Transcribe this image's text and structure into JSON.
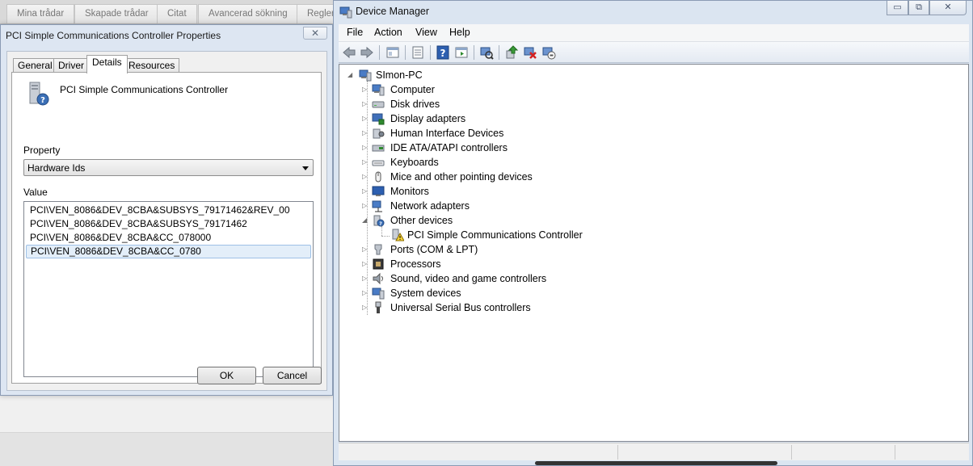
{
  "background_tabs": [
    "Mina trådar",
    "Skapade trådar",
    "Citat",
    "Avancerad sökning",
    "Regler"
  ],
  "properties_dialog": {
    "title": "PCI Simple Communications Controller Properties",
    "close_glyph": "✕",
    "tabs": [
      {
        "label": "General",
        "active": false
      },
      {
        "label": "Driver",
        "active": false
      },
      {
        "label": "Details",
        "active": true
      },
      {
        "label": "Resources",
        "active": false
      }
    ],
    "device_icon": "unknown-device-icon",
    "device_name": "PCI Simple Communications Controller",
    "property_label": "Property",
    "property_value": "Hardware Ids",
    "value_label": "Value",
    "values": [
      {
        "text": "PCI\\VEN_8086&DEV_8CBA&SUBSYS_79171462&REV_00",
        "selected": false
      },
      {
        "text": "PCI\\VEN_8086&DEV_8CBA&SUBSYS_79171462",
        "selected": false
      },
      {
        "text": "PCI\\VEN_8086&DEV_8CBA&CC_078000",
        "selected": false
      },
      {
        "text": "PCI\\VEN_8086&DEV_8CBA&CC_0780",
        "selected": true
      }
    ],
    "ok_label": "OK",
    "cancel_label": "Cancel"
  },
  "device_manager": {
    "title": "Device Manager",
    "window_buttons": {
      "minimize": "▭",
      "restore": "⧉",
      "close": "✕"
    },
    "menu": [
      "File",
      "Action",
      "View",
      "Help"
    ],
    "toolbar_icons": [
      "back-arrow-icon",
      "forward-arrow-icon",
      "show-hide-console-tree-icon",
      "properties-icon",
      "help-icon",
      "action-pane-icon",
      "scan-hardware-icon",
      "update-driver-icon",
      "uninstall-icon",
      "disable-icon"
    ],
    "root": {
      "label": "SImon-PC",
      "expander": "◢"
    },
    "categories": [
      {
        "label": "Computer",
        "icon": "computer-icon",
        "expander": "▷"
      },
      {
        "label": "Disk drives",
        "icon": "disk-drive-icon",
        "expander": "▷"
      },
      {
        "label": "Display adapters",
        "icon": "display-adapter-icon",
        "expander": "▷"
      },
      {
        "label": "Human Interface Devices",
        "icon": "hid-icon",
        "expander": "▷"
      },
      {
        "label": "IDE ATA/ATAPI controllers",
        "icon": "ide-controller-icon",
        "expander": "▷"
      },
      {
        "label": "Keyboards",
        "icon": "keyboard-icon",
        "expander": "▷"
      },
      {
        "label": "Mice and other pointing devices",
        "icon": "mouse-icon",
        "expander": "▷"
      },
      {
        "label": "Monitors",
        "icon": "monitor-icon",
        "expander": "▷"
      },
      {
        "label": "Network adapters",
        "icon": "network-adapter-icon",
        "expander": "▷"
      },
      {
        "label": "Other devices",
        "icon": "other-devices-icon",
        "expander": "◢"
      },
      {
        "label": "PCI Simple Communications Controller",
        "icon": "warning-device-icon",
        "child": true
      },
      {
        "label": "Ports (COM & LPT)",
        "icon": "port-icon",
        "expander": "▷"
      },
      {
        "label": "Processors",
        "icon": "processor-icon",
        "expander": "▷"
      },
      {
        "label": "Sound, video and game controllers",
        "icon": "sound-icon",
        "expander": "▷"
      },
      {
        "label": "System devices",
        "icon": "system-devices-icon",
        "expander": "▷"
      },
      {
        "label": "Universal Serial Bus controllers",
        "icon": "usb-icon",
        "expander": "▷"
      }
    ]
  }
}
